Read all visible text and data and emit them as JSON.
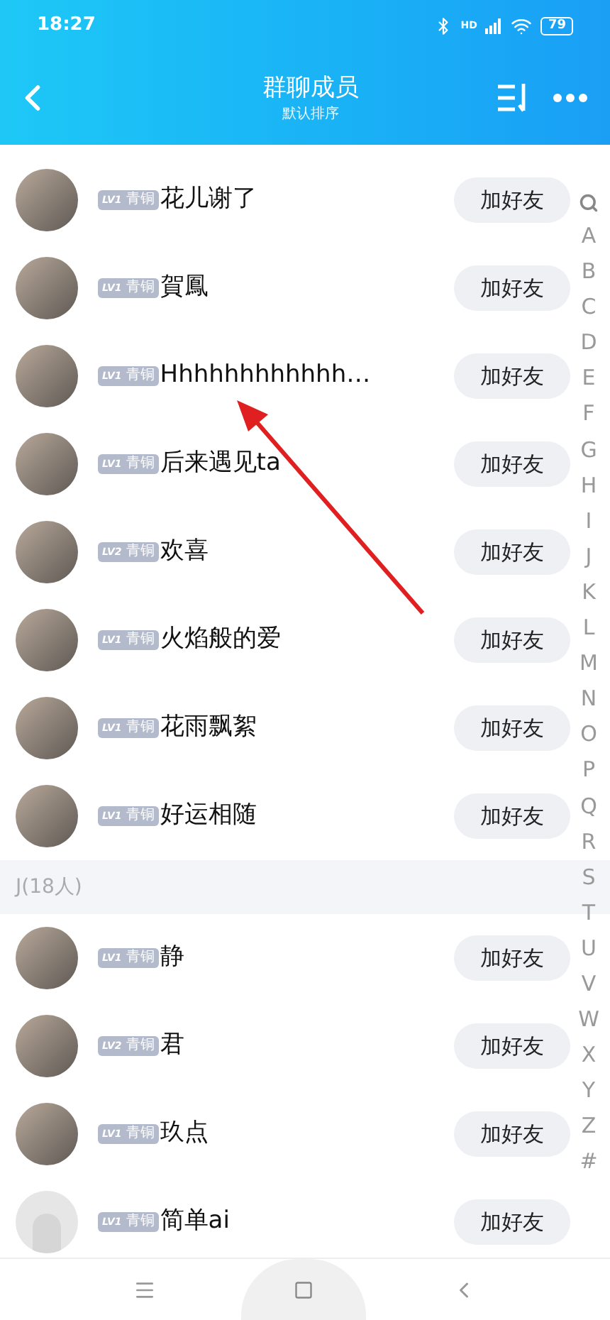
{
  "status_bar": {
    "time": "18:27",
    "network": "HD",
    "battery": "79"
  },
  "header": {
    "title": "群聊成员",
    "subtitle": "默认排序"
  },
  "groups": [
    {
      "members": [
        {
          "name": "花儿谢了",
          "lv": "LV1",
          "rank": "青铜",
          "kind": "photo",
          "action": "加好友"
        },
        {
          "name": "賀鳳",
          "lv": "LV1",
          "rank": "青铜",
          "kind": "photo",
          "action": "加好友"
        },
        {
          "name": "Hhhhhhhhhhhh…",
          "lv": "LV1",
          "rank": "青铜",
          "kind": "photo",
          "action": "加好友"
        },
        {
          "name": "后来遇见ta",
          "lv": "LV1",
          "rank": "青铜",
          "kind": "photo",
          "action": "加好友"
        },
        {
          "name": "欢喜",
          "lv": "LV2",
          "rank": "青铜",
          "kind": "photo",
          "action": "加好友"
        },
        {
          "name": "火焰般的爱",
          "lv": "LV1",
          "rank": "青铜",
          "kind": "photo",
          "action": "加好友"
        },
        {
          "name": "花雨飘絮",
          "lv": "LV1",
          "rank": "青铜",
          "kind": "photo",
          "action": "加好友"
        },
        {
          "name": "好运相随",
          "lv": "LV1",
          "rank": "青铜",
          "kind": "photo",
          "action": "加好友"
        }
      ]
    },
    {
      "title": "J(18人)",
      "members": [
        {
          "name": "静",
          "lv": "LV1",
          "rank": "青铜",
          "kind": "photo",
          "action": "加好友"
        },
        {
          "name": "君",
          "lv": "LV2",
          "rank": "青铜",
          "kind": "photo",
          "action": "加好友"
        },
        {
          "name": "玖点",
          "lv": "LV1",
          "rank": "青铜",
          "kind": "photo",
          "action": "加好友"
        },
        {
          "name": "简单ai",
          "lv": "LV1",
          "rank": "青铜",
          "kind": "default",
          "action": "加好友"
        }
      ]
    }
  ],
  "index": [
    "A",
    "B",
    "C",
    "D",
    "E",
    "F",
    "G",
    "H",
    "I",
    "J",
    "K",
    "L",
    "M",
    "N",
    "O",
    "P",
    "Q",
    "R",
    "S",
    "T",
    "U",
    "V",
    "W",
    "X",
    "Y",
    "Z",
    "#"
  ]
}
